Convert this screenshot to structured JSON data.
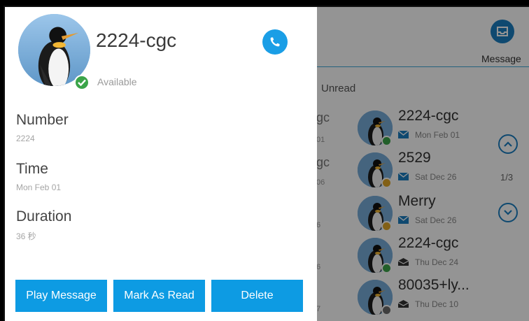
{
  "background": {
    "message_button_label": "Message",
    "filter_label": "Unread",
    "partial_texts": [
      "gc",
      "01",
      "gc",
      "06",
      "6",
      "6",
      "7"
    ],
    "page_indicator": "1/3",
    "entries": [
      {
        "name": "2224-cgc",
        "date": "Mon Feb 01",
        "status": "available",
        "read": false
      },
      {
        "name": "2529",
        "date": "Sat Dec 26",
        "status": "away",
        "read": false
      },
      {
        "name": "Merry",
        "date": "Sat Dec 26",
        "status": "away",
        "read": false
      },
      {
        "name": "2224-cgc",
        "date": "Thu Dec 24",
        "status": "available",
        "read": true
      },
      {
        "name": "80035+ly...",
        "date": "Thu Dec 10",
        "status": "offline",
        "read": true
      }
    ]
  },
  "detail": {
    "name": "2224-cgc",
    "presence": "Available",
    "fields": [
      {
        "label": "Number",
        "value": "2224"
      },
      {
        "label": "Time",
        "value": "Mon Feb 01"
      },
      {
        "label": "Duration",
        "value": "36 秒"
      }
    ],
    "buttons": {
      "play": "Play Message",
      "mark_read": "Mark As Read",
      "delete": "Delete"
    }
  },
  "colors": {
    "accent": "#0d9be3",
    "available": "#3ba449",
    "away": "#e0a526",
    "offline": "#6b6b6b"
  }
}
